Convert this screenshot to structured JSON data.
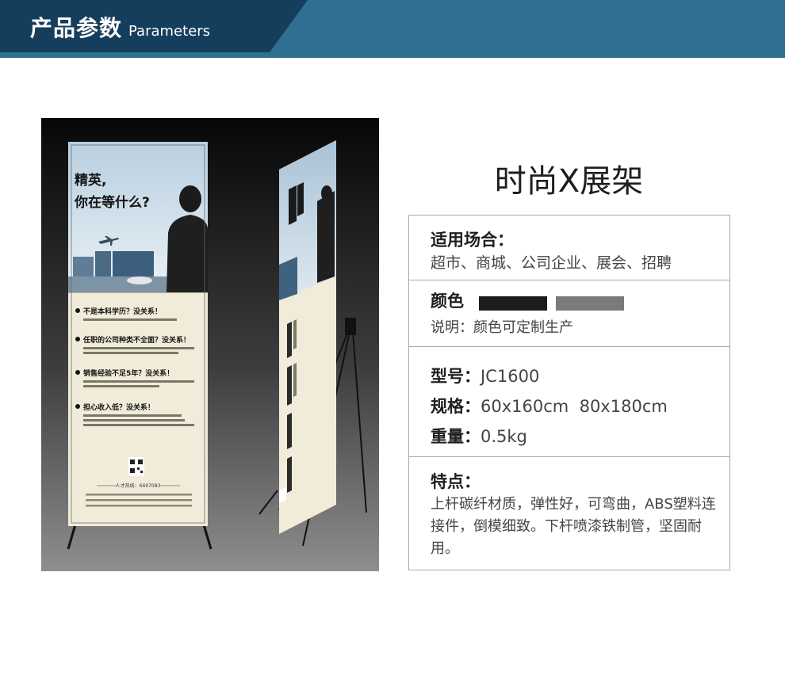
{
  "header": {
    "title": "产品参数",
    "subtitle": "Parameters",
    "color": "#2f6f91",
    "dark_color": "#153e5c"
  },
  "product": {
    "name": "时尚X展架"
  },
  "poster": {
    "headline_line1": "精英,",
    "headline_line2": "你在等什么?",
    "bullets": [
      {
        "title": "不是本科学历？没关系！",
        "text": "市场营销或相关专业中专以上学历，有一年以上市场营销经验。"
      },
      {
        "title": "任职的公司种类不全面？没关系！",
        "text": "熟悉本行业相关运营模式，熟知路线流程，具有较强的市场开拓能力和良好的职业素养。"
      },
      {
        "title": "销售经验不足5年？没关系！",
        "text": "拥有同等职务一年以上，有较强的开业知识，市场营销能力，有成功的销售业绩。"
      },
      {
        "title": "担心收入低？没关系！",
        "text": "正式员工享受：优厚底薪（1950~3750元）+业务提成+年薪奖金+社保五险。海医体检与您一起，实现自我价值，年薪百万当然不是梦！"
      }
    ],
    "hotline": "人才热线：6697083",
    "footer": "健康体检中心地址：海南省海口市龙华区城西学院路3号交通路线：乘44路车至终点站前行200米即到，或乘坐19、20、31、33路在学院路口站下车，沿学院路直行600米即到"
  },
  "specs": {
    "occasion_label": "适用场合：",
    "occasion_value": "超市、商城、公司企业、展会、招聘",
    "color_label": "颜色",
    "color_swatches": [
      "#1c1c1c",
      "#7a7a7a"
    ],
    "color_note": "说明：颜色可定制生产",
    "model_label": "型号：",
    "model_value": "JC1600",
    "size_label": "规格：",
    "size_value": "60x160cm  80x180cm",
    "weight_label": "重量：",
    "weight_value": "0.5kg",
    "features_label": "特点：",
    "features_value": "上杆碳纤材质，弹性好，可弯曲，ABS塑料连接件，倒模细致。下杆喷漆铁制管，坚固耐用。"
  }
}
